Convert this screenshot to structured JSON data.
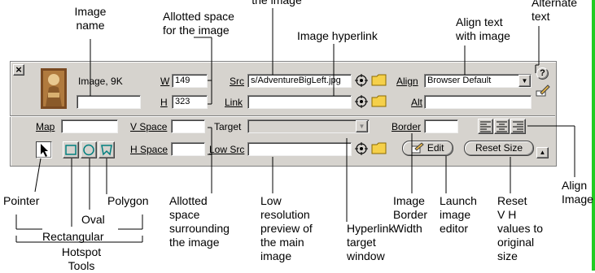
{
  "callouts": {
    "image_name": "Image\nname",
    "allotted_space": "Allotted space\nfor the image",
    "src_partial": "the image",
    "image_hyperlink": "Image hyperlink",
    "align_text": "Align text\nwith image",
    "alternate_text": "Alternate\ntext",
    "pointer": "Pointer",
    "oval": "Oval",
    "polygon": "Polygon",
    "rectangular": "Rectangular",
    "hotspot_tools": "Hotspot\nTools",
    "allotted_surrounding": "Allotted\nspace\nsurrounding\nthe image",
    "low_res": "Low\nresolution\npreview of\nthe main\nimage",
    "hyperlink_target": "Hyperlink\ntarget\nwindow",
    "image_border": "Image\nBorder\nWidth",
    "launch_editor": "Launch\nimage\neditor",
    "reset_vh": "Reset\nV H\nvalues to\noriginal\nsize",
    "align_image": "Align\nImage"
  },
  "inspector": {
    "image_info": "Image, 9K",
    "name_value": "",
    "w_label": "W",
    "w_value": "149",
    "h_label": "H",
    "h_value": "323",
    "src_label": "Src",
    "src_value": "s/AdventureBigLeft.jpg",
    "link_label": "Link",
    "link_value": "",
    "align_label": "Align",
    "align_value": "Browser Default",
    "alt_label": "Alt",
    "alt_value": "",
    "map_label": "Map",
    "map_value": "",
    "vspace_label": "V Space",
    "vspace_value": "",
    "hspace_label": "H Space",
    "hspace_value": "",
    "target_label": "Target",
    "target_value": "",
    "lowsrc_label": "Low Src",
    "lowsrc_value": "",
    "border_label": "Border",
    "border_value": "",
    "edit_label": "Edit",
    "reset_size_label": "Reset Size",
    "help_glyph": "?",
    "close_glyph": "×"
  },
  "colors": {
    "panel_bg": "#d6d3ce",
    "accent_green": "#22cc22",
    "folder_yellow": "#f5d04a",
    "hotspot_teal": "#007f7f"
  }
}
